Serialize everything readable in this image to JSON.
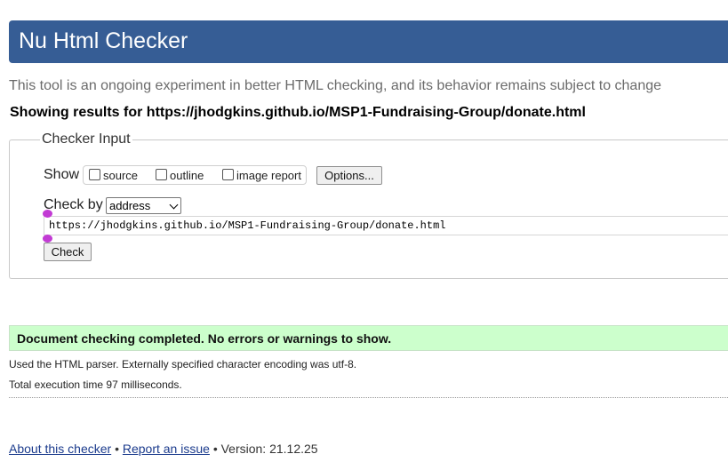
{
  "header": {
    "title": "Nu Html Checker"
  },
  "tagline": "This tool is an ongoing experiment in better HTML checking, and its behavior remains subject to change",
  "showing": {
    "text": "Showing results for https://jhodgkins.github.io/MSP1-Fundraising-Group/donate.html"
  },
  "checker_input": {
    "legend": "Checker Input",
    "show_label": "Show",
    "options": [
      {
        "label": "source",
        "checked": false
      },
      {
        "label": "outline",
        "checked": false
      },
      {
        "label": "image report",
        "checked": false
      }
    ],
    "options_button": "Options...",
    "check_by_label": "Check by",
    "check_by_value": "address",
    "url_value": "https://jhodgkins.github.io/MSP1-Fundraising-Group/donate.html",
    "check_button": "Check"
  },
  "results": {
    "success_message": "Document checking completed. No errors or warnings to show.",
    "parser_info": "Used the HTML parser. Externally specified character encoding was utf-8.",
    "execution_time": "Total execution time 97 milliseconds."
  },
  "footer": {
    "about_link": "About this checker",
    "separator": "•",
    "report_link": "Report an issue",
    "version": "Version: 21.12.25"
  },
  "colors": {
    "header_bg": "#365d95",
    "success_bg": "#ccffcc",
    "link": "#1a3a8c",
    "handle": "#c23bd4"
  }
}
